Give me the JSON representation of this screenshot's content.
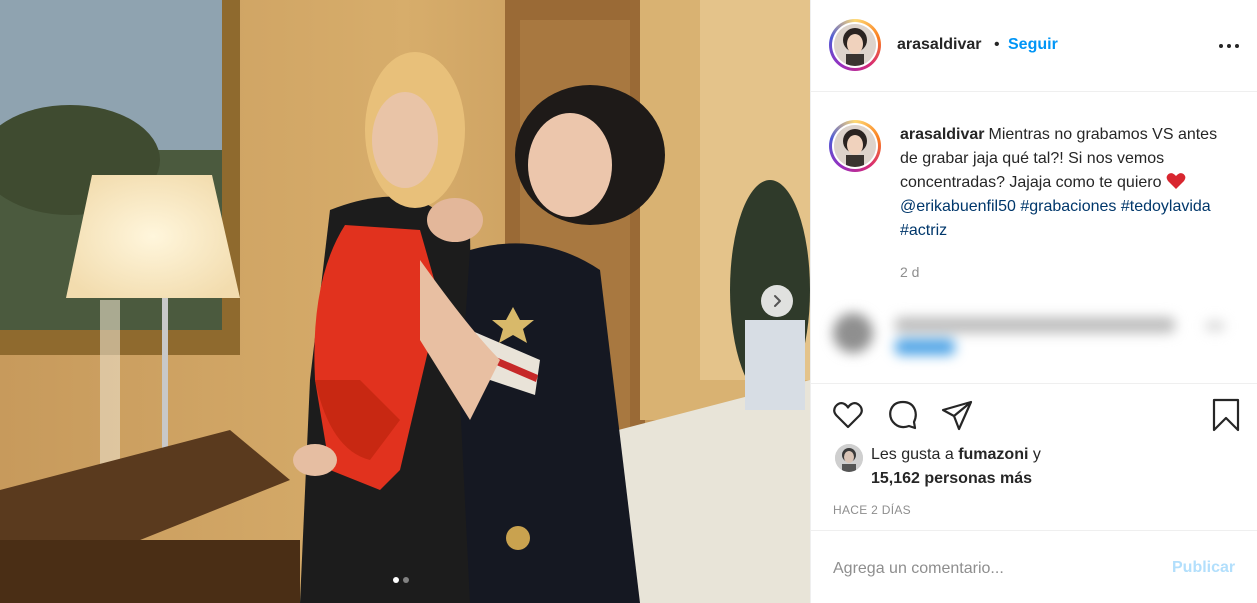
{
  "post": {
    "username": "arasaldivar",
    "separator": "•",
    "follow_label": "Seguir",
    "more_icon": "more-options-icon"
  },
  "caption": {
    "username": "arasaldivar",
    "text": "Mientras no grabamos VS antes de grabar jaja qué tal?! Si nos vemos concentradas? Jajaja como te quiero",
    "emoji": "heart-emoji",
    "mention": "@erikabuenfil50",
    "hashtags": [
      "#grabaciones",
      "#tedoylavida",
      "#actriz"
    ],
    "age": "2 d"
  },
  "likes": {
    "prefix": "Les gusta a",
    "liker": "fumazoni",
    "connector": "y",
    "others": "15,162 personas más"
  },
  "timestamp": "HACE 2 DÍAS",
  "comment_box": {
    "placeholder": "Agrega un comentario...",
    "publish_label": "Publicar"
  },
  "carousel": {
    "current_slide": 1,
    "total_slides": 2,
    "next_icon": "chevron-right-icon"
  },
  "actions": {
    "like_icon": "heart-icon",
    "comment_icon": "comment-icon",
    "share_icon": "share-icon",
    "save_icon": "bookmark-icon"
  },
  "colors": {
    "accent": "#0095f6",
    "link": "#00376b",
    "muted": "#8e8e8e",
    "publish_disabled": "#b2dffc",
    "mention_heart": "#e0245e"
  }
}
